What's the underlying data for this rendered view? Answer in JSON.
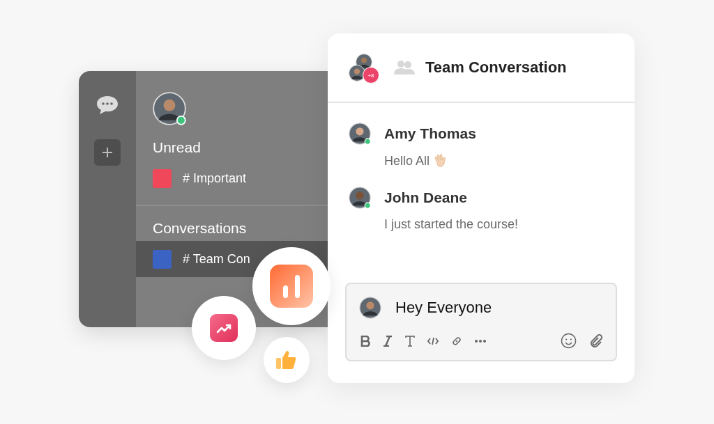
{
  "user": {
    "online": true
  },
  "sections": [
    {
      "title": "Unread",
      "channels": [
        {
          "label": "# Important",
          "color": "#f0475a",
          "selected": false
        }
      ]
    },
    {
      "title": "Conversations",
      "channels": [
        {
          "label": "# Team Con",
          "color": "#3a63c4",
          "selected": true
        }
      ]
    }
  ],
  "chat": {
    "header": {
      "extra_members": "+8",
      "title": "Team Conversation"
    },
    "messages": [
      {
        "author": "Amy Thomas",
        "online": true,
        "text": "Hello All",
        "wave": true
      },
      {
        "author": "John Deane",
        "online": true,
        "text": "I just started the course!",
        "wave": false
      }
    ],
    "composer": {
      "value": "Hey Everyone"
    }
  }
}
